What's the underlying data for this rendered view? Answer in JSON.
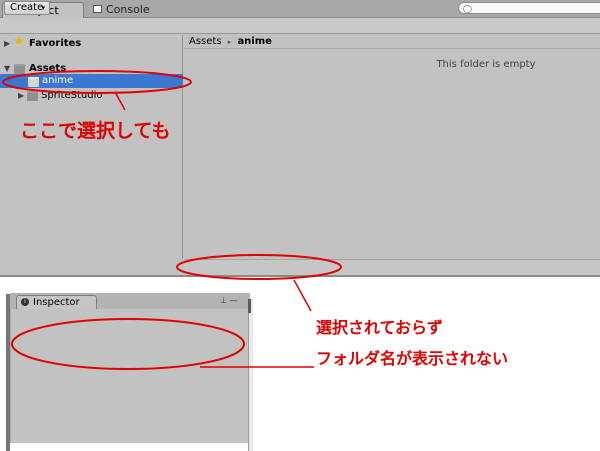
{
  "project_window": {
    "tabs": [
      {
        "label": "Project",
        "icon": "project-icon",
        "active": true
      },
      {
        "label": "Console",
        "icon": "console-icon",
        "active": false
      }
    ],
    "toolbar": {
      "create_label": "Create",
      "create_arrow": "▾",
      "search_icon": "search-icon"
    },
    "favorites_label": "Favorites",
    "assets_label": "Assets",
    "tree_items": [
      {
        "label": "anime",
        "selected": true
      },
      {
        "label": "SpriteStudio",
        "selected": false
      }
    ],
    "breadcrumb": {
      "root": "Assets",
      "separator": "▸",
      "current": "anime"
    },
    "empty_message": "This folder is empty"
  },
  "inspector_window": {
    "tab_label": "Inspector",
    "info_icon": "i",
    "controls": "⊥ —"
  },
  "annotations": {
    "note_selection": "ここで選択しても",
    "note_not_selected": "選択されておらず",
    "note_no_folder_name": "フォルダ名が表示されない",
    "color": "#e00000"
  },
  "colors": {
    "selection": "#3b78d3",
    "panel": "#c2c2c2"
  }
}
